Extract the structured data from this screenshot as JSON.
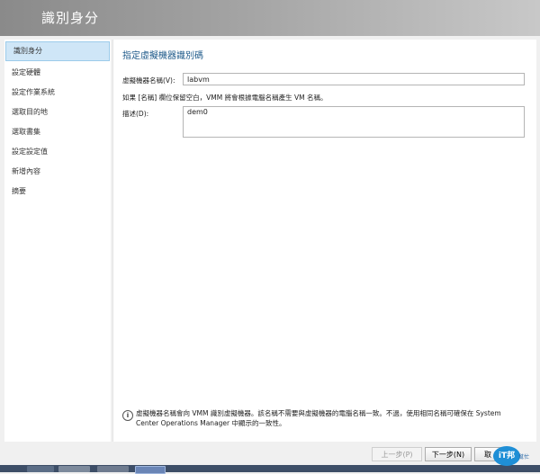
{
  "window": {
    "title": "識別身分"
  },
  "sidebar": {
    "items": [
      {
        "label": "識別身分",
        "active": true
      },
      {
        "label": "設定硬體"
      },
      {
        "label": "設定作業系統"
      },
      {
        "label": "選取目的地"
      },
      {
        "label": "選取書集"
      },
      {
        "label": "設定設定值"
      },
      {
        "label": "新增內容"
      },
      {
        "label": "摘要"
      }
    ]
  },
  "main": {
    "section_title": "指定虛擬機器識別碼",
    "vm_name_label": "虛擬機器名稱(V):",
    "vm_name_value": "labvm",
    "hint": "如果 [名稱] 欄位保留空白，VMM 將會根據電腦名稱產生 VM 名稱。",
    "description_label": "描述(D):",
    "description_value": "dem0",
    "info_text": "虛擬機器名稱會向 VMM 識別虛擬機器。該名稱不需要與虛擬機器的電腦名稱一致。不過，使用相同名稱可確保在 System Center Operations Manager 中顯示的一致性。"
  },
  "footer": {
    "prev_label": "上一步(P)",
    "next_label": "下一步(N)",
    "cancel_label": "取"
  },
  "watermark": {
    "logo": "iT邦",
    "sub": "幫忙"
  }
}
